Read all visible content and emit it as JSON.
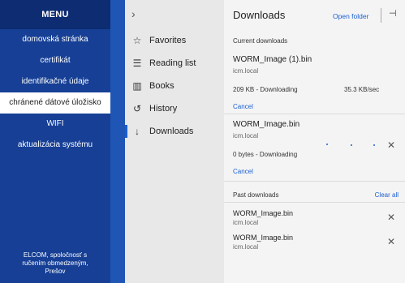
{
  "left_menu": {
    "title": "MENU",
    "items": [
      {
        "label": "domovská stránka"
      },
      {
        "label": "certifikát"
      },
      {
        "label": "identifikačné údaje"
      },
      {
        "label": "chránené dátové úložisko",
        "active": true
      },
      {
        "label": "WIFI"
      },
      {
        "label": "aktualizácia systému"
      }
    ],
    "footer": [
      "ELCOM, spoločnosť s",
      "ručením obmedzeným,",
      "Prešov"
    ]
  },
  "hub_nav": {
    "chevron": "›",
    "items": [
      {
        "label": "Favorites",
        "icon": "star-icon",
        "glyph": "☆"
      },
      {
        "label": "Reading list",
        "icon": "reading-list-icon",
        "glyph": "☰"
      },
      {
        "label": "Books",
        "icon": "books-icon",
        "glyph": "▥"
      },
      {
        "label": "History",
        "icon": "history-icon",
        "glyph": "↺"
      },
      {
        "label": "Downloads",
        "icon": "download-icon",
        "glyph": "↓",
        "active": true
      }
    ]
  },
  "downloads": {
    "title": "Downloads",
    "open_folder": "Open folder",
    "pin_glyph": "⊣",
    "current_label": "Current downloads",
    "current": [
      {
        "name": "WORM_Image (1).bin",
        "host": "icm.local",
        "status": "209 KB - Downloading",
        "speed": "35.3 KB/sec",
        "cancel": "Cancel"
      },
      {
        "name": "WORM_Image.bin",
        "host": "icm.local",
        "status": "0 bytes - Downloading",
        "cancel": "Cancel",
        "close": "✕"
      }
    ],
    "past_label": "Past downloads",
    "clear_all": "Clear all",
    "past": [
      {
        "name": "WORM_Image.bin",
        "host": "icm.local",
        "close": "✕"
      },
      {
        "name": "WORM_Image.bin",
        "host": "icm.local",
        "close": "✕"
      }
    ]
  },
  "colors": {
    "menu_bg": "#163f95",
    "menu_title_bg": "#0d2c72",
    "accent_link": "#1a5fd1",
    "nav_bg": "#e8e8e8",
    "panel_bg": "#f4f4f4"
  }
}
